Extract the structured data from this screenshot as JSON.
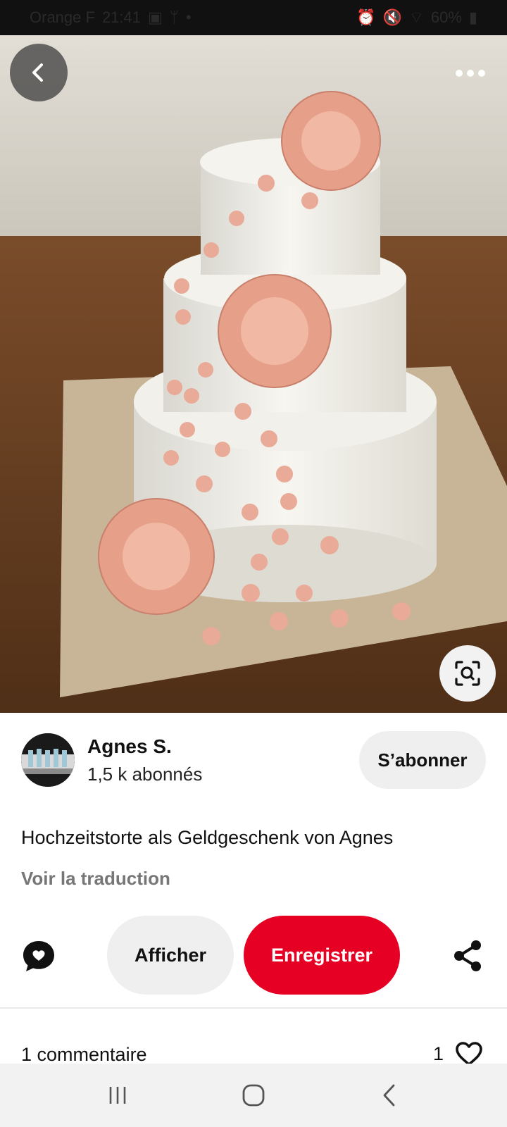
{
  "status_bar": {
    "carrier": "Orange F",
    "time": "21:41",
    "battery": "60%",
    "icons": [
      "image-icon",
      "signal-icon",
      "alarm-icon",
      "mute-icon",
      "wifi-icon",
      "battery-icon"
    ]
  },
  "hero": {
    "back_icon": "chevron-left-icon",
    "more_icon": "more-horizontal-icon",
    "lens_icon": "visual-search-icon"
  },
  "profile": {
    "name": "Agnes S.",
    "followers": "1,5 k abonnés",
    "subscribe_label": "S’abonner"
  },
  "pin": {
    "title": "Hochzeitstorte als Geldgeschenk von Agnes",
    "translate_label": "Voir la traduction"
  },
  "actions": {
    "view_label": "Afficher",
    "save_label": "Enregistrer",
    "comment_icon": "comment-bubble-icon",
    "share_icon": "share-icon"
  },
  "comments": {
    "count_label": "1 commentaire",
    "likes": "1"
  },
  "colors": {
    "accent": "#e60023",
    "pill_bg": "#efefef",
    "muted_text": "#767676"
  }
}
